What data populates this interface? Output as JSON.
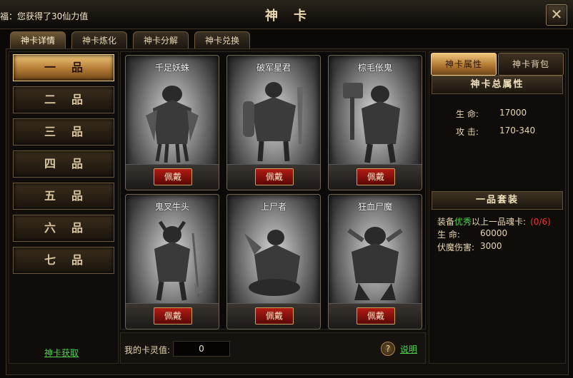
{
  "notice": "福：您获得了30仙力值",
  "window": {
    "title": "神卡",
    "close_glyph": "✕"
  },
  "tabs": [
    {
      "label": "神卡详情",
      "active": true
    },
    {
      "label": "神卡炼化",
      "active": false
    },
    {
      "label": "神卡分解",
      "active": false
    },
    {
      "label": "神卡兑换",
      "active": false
    }
  ],
  "grades": [
    {
      "label": "一品",
      "active": true
    },
    {
      "label": "二品",
      "active": false
    },
    {
      "label": "三品",
      "active": false
    },
    {
      "label": "四品",
      "active": false
    },
    {
      "label": "五品",
      "active": false
    },
    {
      "label": "六品",
      "active": false
    },
    {
      "label": "七品",
      "active": false
    }
  ],
  "obtain_link": "神卡获取",
  "cards": [
    {
      "name": "千足妖蛛",
      "equip_label": "佩戴"
    },
    {
      "name": "破军星君",
      "equip_label": "佩戴"
    },
    {
      "name": "棕毛伥鬼",
      "equip_label": "佩戴"
    },
    {
      "name": "鬼叉牛头",
      "equip_label": "佩戴"
    },
    {
      "name": "上尸者",
      "equip_label": "佩戴"
    },
    {
      "name": "狂血尸魔",
      "equip_label": "佩戴"
    }
  ],
  "spirit": {
    "label": "我的卡灵值:",
    "value": "0"
  },
  "help_glyph": "?",
  "explain_link": "说明",
  "right_tabs": [
    {
      "label": "神卡属性",
      "active": true
    },
    {
      "label": "神卡背包",
      "active": false
    }
  ],
  "total_attr": {
    "heading": "神卡总属性",
    "rows": [
      {
        "label": "生    命:",
        "value": "17000"
      },
      {
        "label": "攻    击:",
        "value": "170-340"
      }
    ]
  },
  "set": {
    "heading": "一品套装",
    "req_prefix": "装备",
    "req_quality": "优秀",
    "req_suffix": "以上一品魂卡:",
    "req_count": "(0/6)",
    "rows": [
      {
        "label": "生    命:",
        "value": "60000"
      },
      {
        "label": "伏魔伤害:",
        "value": "3000"
      }
    ]
  },
  "colors": {
    "link_green": "#4fd34f",
    "count_red": "#e83a2a",
    "quality_green": "#4fd34f",
    "accent_gold": "#d9a657"
  }
}
